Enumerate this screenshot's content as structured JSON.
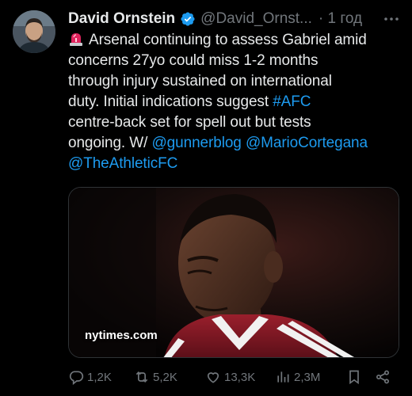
{
  "tweet": {
    "author_name": "David Ornstein",
    "handle": "@David_Ornst...",
    "time": "· 1 год",
    "lines": [
      {
        "parts": [
          {
            "t": "Arsenal continuing to assess Gabriel amid",
            "link": false
          }
        ]
      },
      {
        "parts": [
          {
            "t": "concerns 27yo could miss 1-2 months",
            "link": false
          }
        ]
      },
      {
        "parts": [
          {
            "t": "through injury sustained on international",
            "link": false
          }
        ]
      },
      {
        "parts": [
          {
            "t": "duty. Initial indications suggest ",
            "link": false
          },
          {
            "t": "#AFC",
            "link": true
          }
        ]
      },
      {
        "parts": [
          {
            "t": "centre-back set for spell out but tests",
            "link": false
          }
        ]
      },
      {
        "parts": [
          {
            "t": "ongoing. W/ ",
            "link": false
          },
          {
            "t": "@gunnerblog",
            "link": true
          },
          {
            "t": " ",
            "link": false
          },
          {
            "t": "@MarioCortegana",
            "link": true
          }
        ]
      },
      {
        "parts": [
          {
            "t": "@TheAthleticFC",
            "link": true
          }
        ]
      }
    ],
    "media_domain": "nytimes.com"
  },
  "actions": {
    "replies": "1,2K",
    "reposts": "5,2K",
    "likes": "13,3K",
    "views": "2,3M"
  },
  "colors": {
    "background": "#000000",
    "text": "#e7e9ea",
    "muted": "#71767b",
    "link": "#1d9bf0",
    "verified": "#1d9bf0"
  },
  "icons": [
    "siren-emoji-icon",
    "verified-badge-icon",
    "more-icon",
    "reply-icon",
    "repost-icon",
    "like-icon",
    "views-icon",
    "bookmark-icon",
    "share-icon"
  ]
}
